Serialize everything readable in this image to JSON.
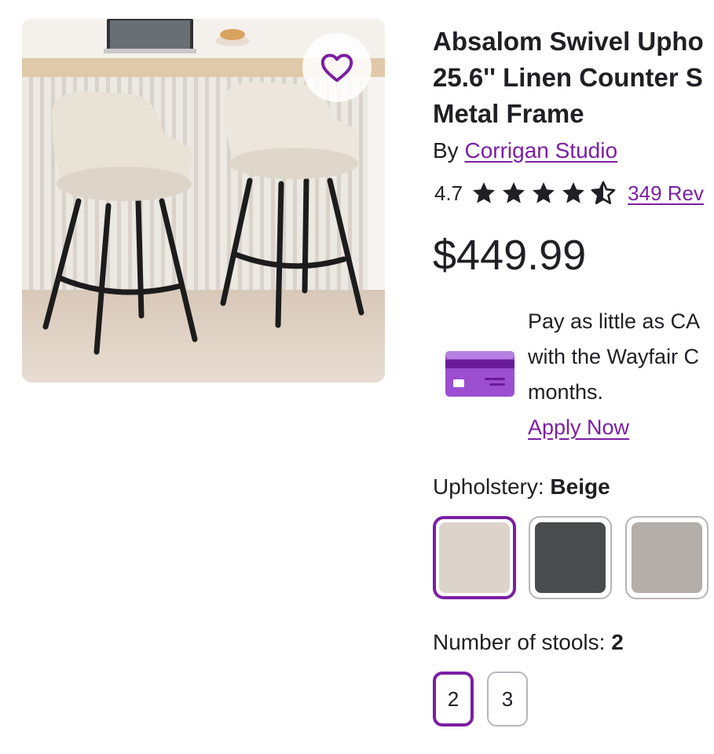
{
  "product": {
    "title_lines": [
      "Absalom Swivel Upho",
      "25.6'' Linen Counter S",
      "Metal Frame"
    ],
    "by_prefix": "By",
    "brand": "Corrigan Studio",
    "rating": "4.7",
    "stars": 4.7,
    "reviews_link": "349 Rev",
    "price": "$449.99",
    "image_alt": "two beige upholstered swivel counter stools with black metal legs"
  },
  "favorite": {
    "icon": "heart-outline-icon"
  },
  "financing": {
    "icon": "credit-card-icon",
    "lines": [
      "Pay as little as CA",
      "with the Wayfair C",
      "months."
    ],
    "apply_label": "Apply Now"
  },
  "upholstery": {
    "label": "Upholstery:",
    "selected": "Beige",
    "swatches": [
      {
        "name": "Beige",
        "color": "#dcd4cb"
      },
      {
        "name": "Dark Gray",
        "color": "#4a4b4d"
      },
      {
        "name": "Light Gray",
        "color": "#b3aea9"
      }
    ]
  },
  "stools": {
    "label": "Number of stools:",
    "selected": "2",
    "options": [
      "2",
      "3"
    ]
  },
  "colors": {
    "accent": "#7b1fa2",
    "text": "#1f1f24",
    "border": "#b9b5bb"
  }
}
